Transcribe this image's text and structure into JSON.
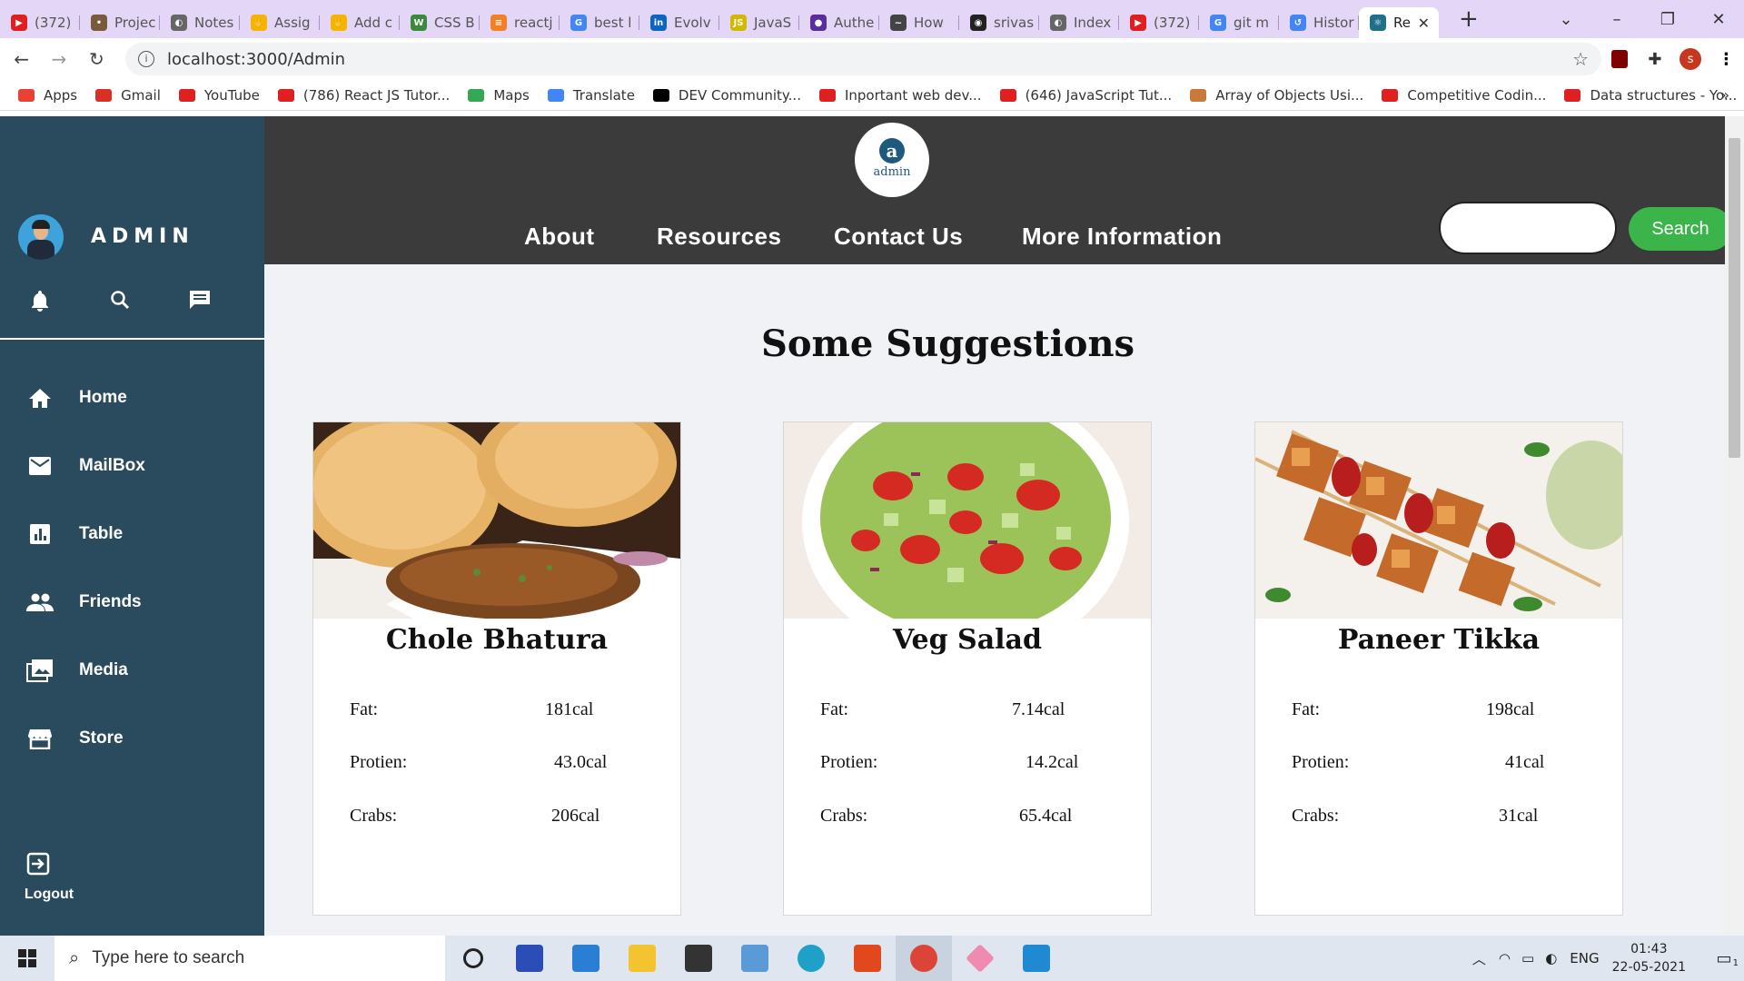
{
  "browser": {
    "tabs": [
      {
        "title": "(372)",
        "color": "#e02020",
        "glyph": "▶"
      },
      {
        "title": "Projec",
        "color": "#7a5a3a",
        "glyph": "•"
      },
      {
        "title": "Notes",
        "color": "#666666",
        "glyph": "◐"
      },
      {
        "title": "Assig",
        "color": "#f4b400",
        "glyph": "✋"
      },
      {
        "title": "Add c",
        "color": "#f4b400",
        "glyph": "✋"
      },
      {
        "title": "CSS B",
        "color": "#3b8a3b",
        "glyph": "W"
      },
      {
        "title": "reactj",
        "color": "#f48024",
        "glyph": "≡"
      },
      {
        "title": "best l",
        "color": "#4285f4",
        "glyph": "G"
      },
      {
        "title": "Evolv",
        "color": "#0a66c2",
        "glyph": "in"
      },
      {
        "title": "JavaS",
        "color": "#d4b800",
        "glyph": "JS"
      },
      {
        "title": "Authe",
        "color": "#5b2ca0",
        "glyph": "●"
      },
      {
        "title": "How",
        "color": "#444444",
        "glyph": "~"
      },
      {
        "title": "srivas",
        "color": "#222222",
        "glyph": "◉"
      },
      {
        "title": "Index",
        "color": "#666666",
        "glyph": "◐"
      },
      {
        "title": "(372)",
        "color": "#e02020",
        "glyph": "▶"
      },
      {
        "title": "git m",
        "color": "#4285f4",
        "glyph": "G"
      },
      {
        "title": "Histor",
        "color": "#4285f4",
        "glyph": "↺"
      },
      {
        "title": "Re",
        "color": "#1f6f8b",
        "glyph": "⚛",
        "active": true
      }
    ],
    "new_tab_glyph": "+",
    "url": "localhost:3000/Admin",
    "profile_initial": "s",
    "bookmarks": [
      {
        "label": "Apps",
        "color": "#e94235"
      },
      {
        "label": "Gmail",
        "color": "#d93025"
      },
      {
        "label": "YouTube",
        "color": "#e02020"
      },
      {
        "label": "(786) React JS Tutor...",
        "color": "#e02020"
      },
      {
        "label": "Maps",
        "color": "#34a853"
      },
      {
        "label": "Translate",
        "color": "#4285f4"
      },
      {
        "label": "DEV Community...",
        "color": "#000000"
      },
      {
        "label": "Inportant web dev...",
        "color": "#e02020"
      },
      {
        "label": "(646) JavaScript Tut...",
        "color": "#e02020"
      },
      {
        "label": "Array of Objects Usi...",
        "color": "#c87a3a"
      },
      {
        "label": "Competitive Codin...",
        "color": "#e02020"
      },
      {
        "label": "Data structures - Yo...",
        "color": "#e02020"
      }
    ],
    "bookmarks_more": "»"
  },
  "sidebar": {
    "title": "ADMIN",
    "items": [
      {
        "label": "Home",
        "icon": "home-icon"
      },
      {
        "label": "MailBox",
        "icon": "mail-icon"
      },
      {
        "label": "Table",
        "icon": "table-icon"
      },
      {
        "label": "Friends",
        "icon": "friends-icon"
      },
      {
        "label": "Media",
        "icon": "media-icon"
      },
      {
        "label": "Store",
        "icon": "store-icon"
      }
    ],
    "logout_label": "Logout"
  },
  "topnav": {
    "logo_letter": "a",
    "logo_text": "admin",
    "links": [
      "About",
      "Resources",
      "Contact Us",
      "More Information"
    ],
    "search_placeholder": "",
    "search_button": "Search"
  },
  "content": {
    "heading": "Some Suggestions",
    "cards": [
      {
        "name": "Chole Bhatura",
        "rows": [
          {
            "label": "Fat:",
            "value": "181cal"
          },
          {
            "label": "Protien:",
            "value": "43.0cal"
          },
          {
            "label": "Crabs:",
            "value": "206cal"
          }
        ]
      },
      {
        "name": "Veg Salad",
        "rows": [
          {
            "label": "Fat:",
            "value": "7.14cal"
          },
          {
            "label": "Protien:",
            "value": "14.2cal"
          },
          {
            "label": "Crabs:",
            "value": "65.4cal"
          }
        ]
      },
      {
        "name": "Paneer Tikka",
        "rows": [
          {
            "label": "Fat:",
            "value": "198cal"
          },
          {
            "label": "Protien:",
            "value": "41cal"
          },
          {
            "label": "Crabs:",
            "value": "31cal"
          }
        ]
      }
    ]
  },
  "taskbar": {
    "search_placeholder": "Type here to search",
    "language": "ENG",
    "time": "01:43",
    "date": "22-05-2021",
    "notifications": "1"
  }
}
